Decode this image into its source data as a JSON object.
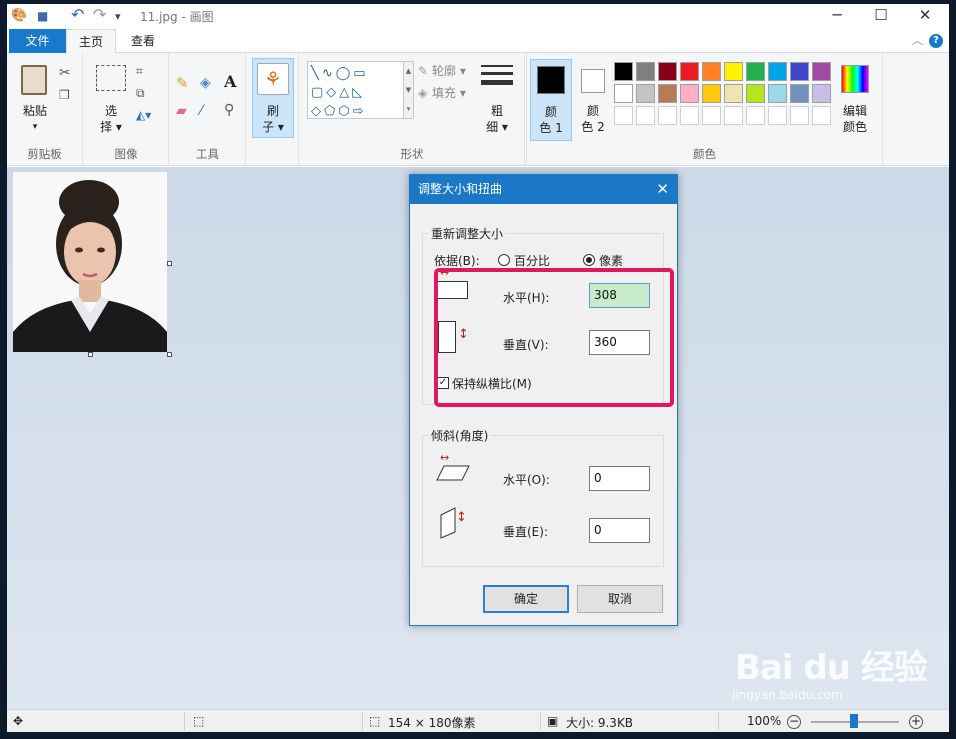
{
  "window": {
    "title": "11.jpg - 画图",
    "minimize": "─",
    "maximize": "☐",
    "close": "✕"
  },
  "quick_access": {
    "undo": "↶",
    "redo": "↷",
    "save": "■",
    "customize": "▾"
  },
  "tabs": {
    "file": "文件",
    "home": "主页",
    "view": "查看"
  },
  "help": {
    "label": "?",
    "collapse": "︿"
  },
  "ribbon": {
    "clipboard": {
      "label": "剪贴板",
      "paste": "粘贴",
      "paste_arrow": "▾"
    },
    "image": {
      "label": "图像",
      "select_1": "选",
      "select_2": "择 ▾"
    },
    "tools": {
      "label": "工具",
      "text_icon": "A"
    },
    "brush": {
      "line1": "刷",
      "line2": "子 ▾"
    },
    "shapes": {
      "label": "形状",
      "outline": "轮廓 ▾",
      "fill": "填充 ▾"
    },
    "size": {
      "line1": "粗",
      "line2": "细 ▾"
    },
    "colors": {
      "label": "颜色",
      "color1_a": "颜",
      "color1_b": "色 1",
      "color2_a": "颜",
      "color2_b": "色 2",
      "edit_a": "编辑",
      "edit_b": "颜色"
    },
    "palette_colors": [
      "#000000",
      "#7f7f7f",
      "#880015",
      "#ed1c24",
      "#ff7f27",
      "#fff200",
      "#22b14c",
      "#00a2e8",
      "#3f48cc",
      "#a349a4",
      "#ffffff",
      "#c3c3c3",
      "#b97a57",
      "#ffaec9",
      "#ffc90e",
      "#efe4b0",
      "#b5e61d",
      "#99d9ea",
      "#7092be",
      "#c8bfe7"
    ]
  },
  "dialog": {
    "title": "调整大小和扭曲",
    "close": "✕",
    "resize_group": "重新调整大小",
    "by_label": "依据(B):",
    "percent": "百分比",
    "pixels": "像素",
    "horizontal_label": "水平(H):",
    "horizontal_value": "308",
    "vertical_label": "垂直(V):",
    "vertical_value": "360",
    "keep_ratio": "保持纵横比(M)",
    "keep_ratio_check": "✓",
    "skew_group": "倾斜(角度)",
    "skew_h_label": "水平(O):",
    "skew_h_value": "0",
    "skew_v_label": "垂直(E):",
    "skew_v_value": "0",
    "ok": "确定",
    "cancel": "取消"
  },
  "status": {
    "image_size": "154 × 180像素",
    "file_size": "大小: 9.3KB",
    "zoom": "100%",
    "zoom_out": "−",
    "zoom_in": "+"
  },
  "watermark": {
    "text": "Bai du 经验",
    "sub": "jingyan.baidu.com"
  }
}
